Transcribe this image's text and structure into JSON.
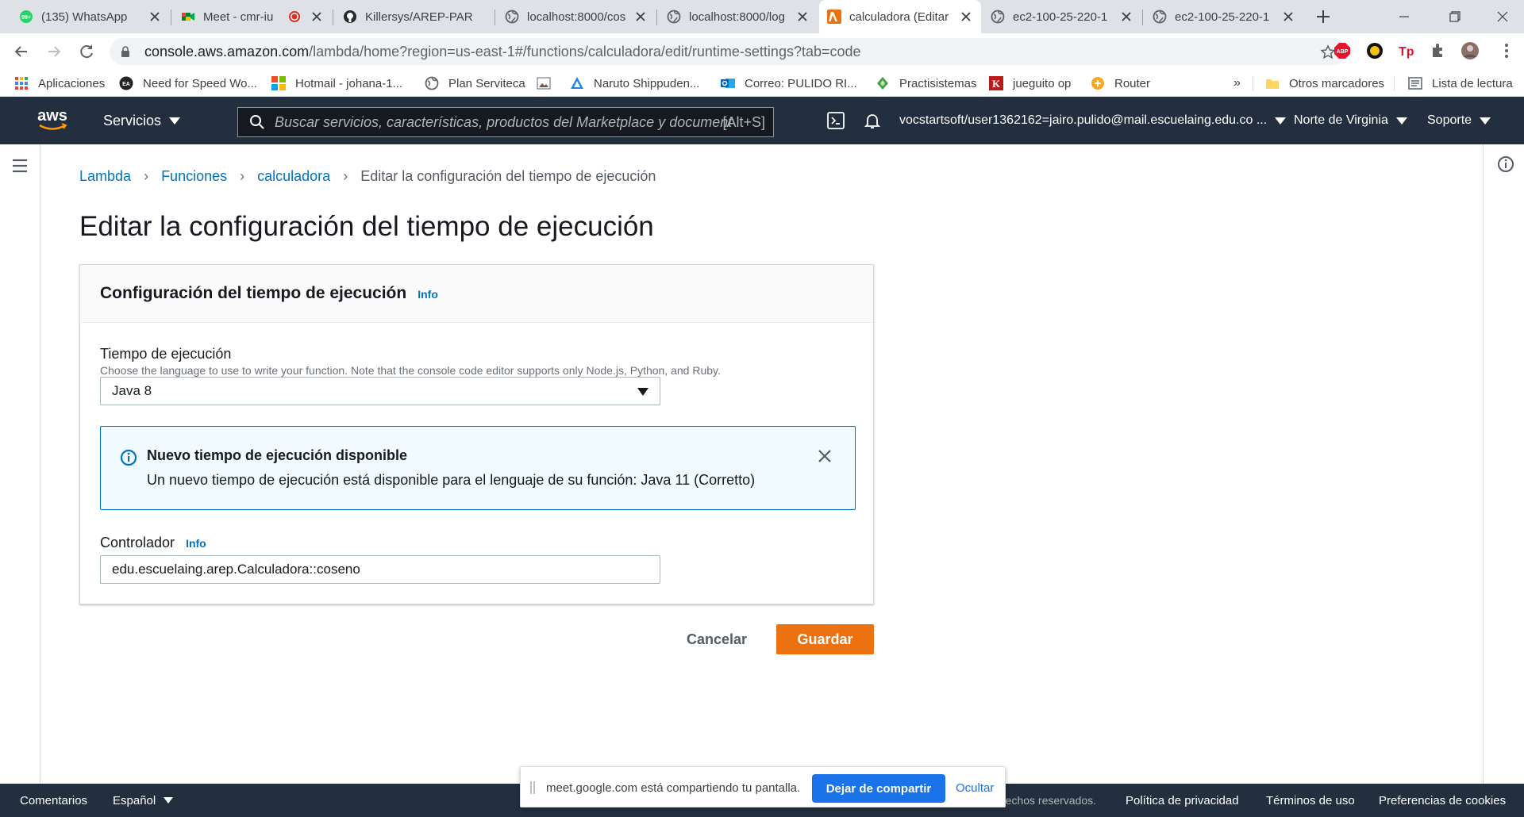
{
  "browser": {
    "tabs": [
      {
        "title": "(135) WhatsApp",
        "icon": "whatsapp-icon"
      },
      {
        "title": "Meet - cmr-iu",
        "icon": "meet-icon"
      },
      {
        "title": "Killersys/AREP-PAR",
        "icon": "github-icon"
      },
      {
        "title": "localhost:8000/cos",
        "icon": "globe-icon"
      },
      {
        "title": "localhost:8000/log",
        "icon": "globe-icon"
      },
      {
        "title": "calculadora (Editar",
        "icon": "lambda-icon"
      },
      {
        "title": "ec2-100-25-220-1",
        "icon": "globe-icon"
      },
      {
        "title": "ec2-100-25-220-1",
        "icon": "globe-icon"
      }
    ],
    "active_tab": 5,
    "url_host": "console.aws.amazon.com",
    "url_path": "/lambda/home?region=us-east-1#/functions/calculadora/edit/runtime-settings?tab=code",
    "bookmarks": [
      {
        "label": "Aplicaciones"
      },
      {
        "label": "Need for Speed Wo..."
      },
      {
        "label": "Hotmail - johana-1..."
      },
      {
        "label": "Plan Serviteca"
      },
      {
        "label": ""
      },
      {
        "label": "Naruto Shippuden..."
      },
      {
        "label": "Correo: PULIDO RI..."
      },
      {
        "label": "Practisistemas"
      },
      {
        "label": "jueguito op"
      },
      {
        "label": "Router"
      }
    ],
    "bookmarks_more": "»",
    "other_bookmarks": "Otros marcadores",
    "reading_list": "Lista de lectura"
  },
  "aws_nav": {
    "logo": "aws",
    "services": "Servicios",
    "search_placeholder": "Buscar servicios, características, productos del Marketplace y document",
    "search_shortcut": "[Alt+S]",
    "account": "vocstartsoft/user1362162=jairo.pulido@mail.escuelaing.edu.co ...",
    "region": "Norte de Virginia",
    "support": "Soporte"
  },
  "breadcrumb": {
    "items": [
      "Lambda",
      "Funciones",
      "calculadora"
    ],
    "current": "Editar la configuración del tiempo de ejecución"
  },
  "page_title": "Editar la configuración del tiempo de ejecución",
  "panel": {
    "title": "Configuración del tiempo de ejecución",
    "info": "Info",
    "runtime_label": "Tiempo de ejecución",
    "runtime_desc": "Choose the language to use to write your function. Note that the console code editor supports only Node.js, Python, and Ruby.",
    "runtime_value": "Java 8",
    "alert_title": "Nuevo tiempo de ejecución disponible",
    "alert_text": "Un nuevo tiempo de ejecución está disponible para el lenguaje de su función: Java 11 (Corretto)",
    "handler_label": "Controlador",
    "handler_info": "Info",
    "handler_value": "edu.escuelaing.arep.Calculadora::coseno"
  },
  "actions": {
    "cancel": "Cancelar",
    "save": "Guardar"
  },
  "footer": {
    "feedback": "Comentarios",
    "language": "Español",
    "rights": "rechos reservados.",
    "privacy": "Política de privacidad",
    "terms": "Términos de uso",
    "cookies": "Preferencias de cookies"
  },
  "share_bar": {
    "text": "meet.google.com está compartiendo tu pantalla.",
    "stop": "Dejar de compartir",
    "hide": "Ocultar"
  },
  "colors": {
    "aws_nav": "#232f3e",
    "primary_button": "#ec7211",
    "link": "#0073bb",
    "alert_bg": "#f1faff"
  }
}
